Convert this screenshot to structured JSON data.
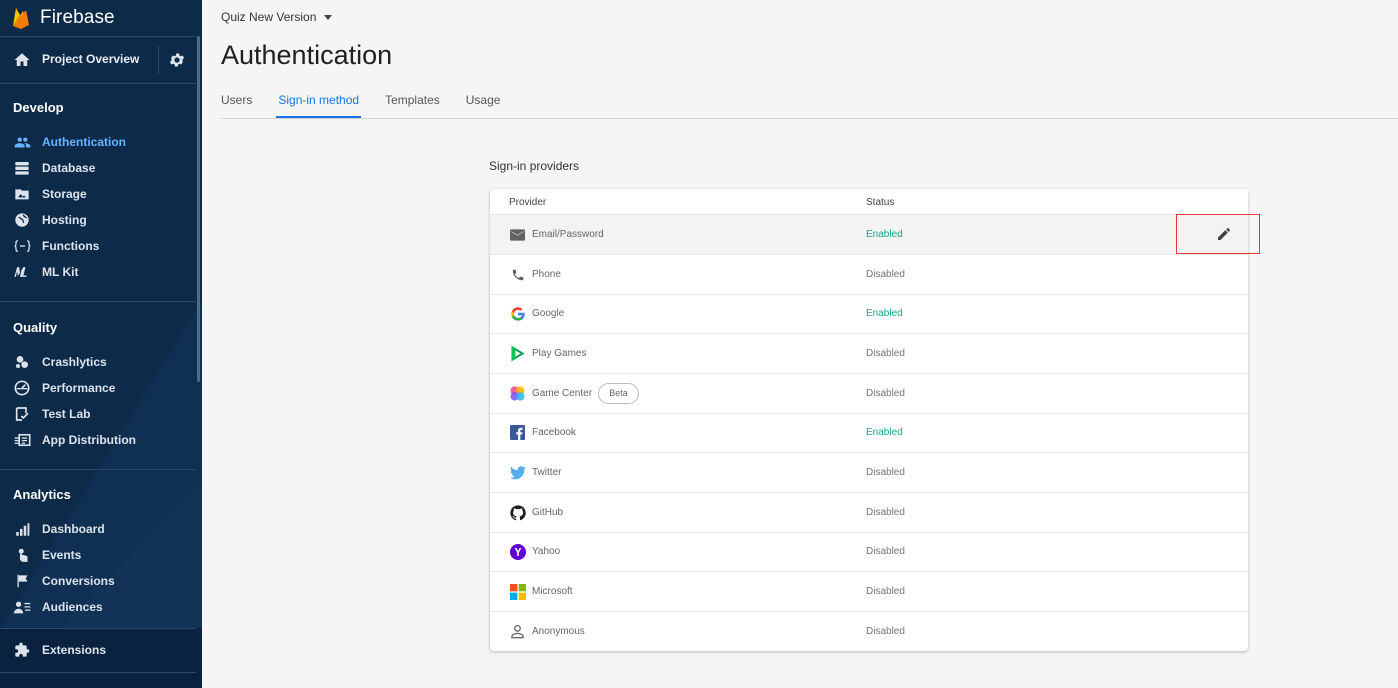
{
  "brand": {
    "name": "Firebase"
  },
  "sidebar": {
    "overview_label": "Project Overview",
    "sections": {
      "develop": "Develop",
      "quality": "Quality",
      "analytics": "Analytics"
    },
    "develop_items": [
      {
        "label": "Authentication",
        "icon": "people-icon",
        "active": true
      },
      {
        "label": "Database",
        "icon": "database-icon"
      },
      {
        "label": "Storage",
        "icon": "folder-image-icon"
      },
      {
        "label": "Hosting",
        "icon": "globe-icon"
      },
      {
        "label": "Functions",
        "icon": "functions-icon"
      },
      {
        "label": "ML Kit",
        "icon": "mlkit-icon"
      }
    ],
    "quality_items": [
      {
        "label": "Crashlytics",
        "icon": "crashlytics-icon"
      },
      {
        "label": "Performance",
        "icon": "performance-icon"
      },
      {
        "label": "Test Lab",
        "icon": "testlab-icon"
      },
      {
        "label": "App Distribution",
        "icon": "app-distribution-icon"
      }
    ],
    "analytics_items": [
      {
        "label": "Dashboard",
        "icon": "bar-chart-icon"
      },
      {
        "label": "Events",
        "icon": "touch-icon"
      },
      {
        "label": "Conversions",
        "icon": "flag-icon"
      },
      {
        "label": "Audiences",
        "icon": "audiences-icon"
      }
    ],
    "extensions_label": "Extensions"
  },
  "header": {
    "project_name": "Quiz New Version",
    "title": "Authentication",
    "tabs": [
      {
        "label": "Users",
        "active": false
      },
      {
        "label": "Sign-in method",
        "active": true
      },
      {
        "label": "Templates",
        "active": false
      },
      {
        "label": "Usage",
        "active": false
      }
    ]
  },
  "providers": {
    "heading": "Sign-in providers",
    "columns": {
      "provider": "Provider",
      "status": "Status"
    },
    "badge_beta": "Beta",
    "rows": [
      {
        "name": "Email/Password",
        "status": "Enabled",
        "icon": "email-icon"
      },
      {
        "name": "Phone",
        "status": "Disabled",
        "icon": "phone-icon"
      },
      {
        "name": "Google",
        "status": "Enabled",
        "icon": "google-icon"
      },
      {
        "name": "Play Games",
        "status": "Disabled",
        "icon": "play-games-icon"
      },
      {
        "name": "Game Center",
        "status": "Disabled",
        "icon": "game-center-icon"
      },
      {
        "name": "Facebook",
        "status": "Enabled",
        "icon": "facebook-icon"
      },
      {
        "name": "Twitter",
        "status": "Disabled",
        "icon": "twitter-icon"
      },
      {
        "name": "GitHub",
        "status": "Disabled",
        "icon": "github-icon"
      },
      {
        "name": "Yahoo",
        "status": "Disabled",
        "icon": "yahoo-icon"
      },
      {
        "name": "Microsoft",
        "status": "Disabled",
        "icon": "microsoft-icon"
      },
      {
        "name": "Anonymous",
        "status": "Disabled",
        "icon": "anonymous-icon"
      }
    ]
  },
  "colors": {
    "sidebar_bg": "#0d2a49",
    "active_nav": "#66b3ff",
    "accent_tab": "#1a73e8",
    "enabled_status": "#1aa68a",
    "highlight_border": "#e53935"
  }
}
